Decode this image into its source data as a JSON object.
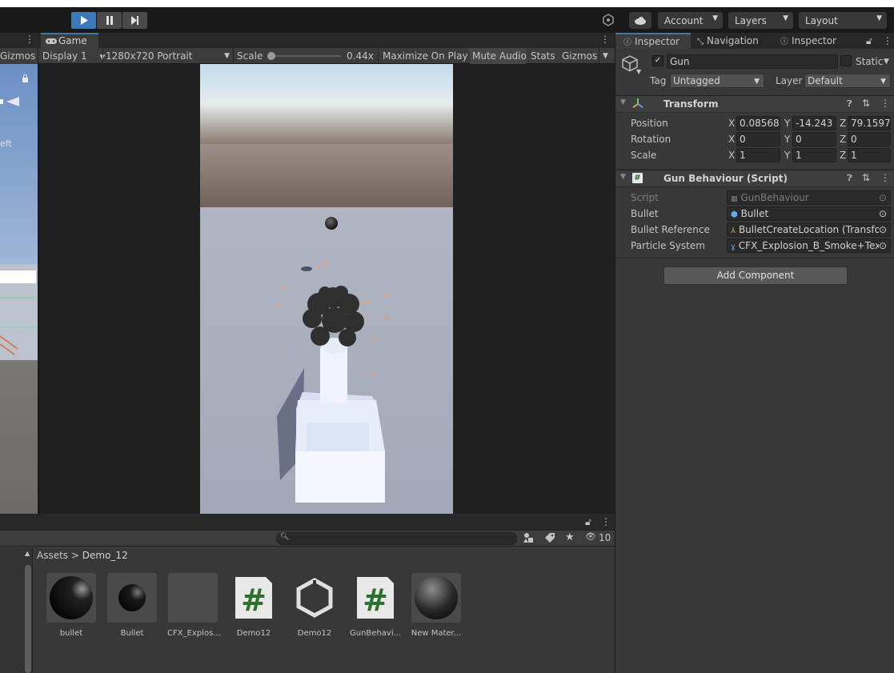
{
  "toolbar": {
    "account_label": "Account",
    "layers_label": "Layers",
    "layout_label": "Layout"
  },
  "scene_panel": {
    "gizmos_label": "Gizmos",
    "persp_fragment": "eft"
  },
  "game_panel": {
    "tab_label": "Game",
    "display_label": "Display 1",
    "resolution_label": "1280x720 Portrait",
    "scale_label": "Scale",
    "scale_value": "0.44x",
    "maximize_label": "Maximize On Play",
    "mute_label": "Mute Audio",
    "stats_label": "Stats",
    "gizmos_label": "Gizmos"
  },
  "inspector": {
    "tabs": [
      {
        "label": "Inspector"
      },
      {
        "label": "Navigation"
      },
      {
        "label": "Inspector"
      }
    ],
    "object_name": "Gun",
    "static_label": "Static",
    "tag_label": "Tag",
    "tag_value": "Untagged",
    "layer_label": "Layer",
    "layer_value": "Default",
    "transform": {
      "title": "Transform",
      "position_label": "Position",
      "rotation_label": "Rotation",
      "scale_label": "Scale",
      "position": {
        "x": "0.08568",
        "y": "-14.243",
        "z": "79.1597"
      },
      "rotation": {
        "x": "0",
        "y": "0",
        "z": "0"
      },
      "scale": {
        "x": "1",
        "y": "1",
        "z": "1"
      }
    },
    "gun_behaviour": {
      "title": "Gun Behaviour (Script)",
      "script_label": "Script",
      "script_value": "GunBehaviour",
      "bullet_label": "Bullet",
      "bullet_value": "Bullet",
      "bullet_ref_label": "Bullet Reference",
      "bullet_ref_value": "BulletCreateLocation (Transfo",
      "particle_label": "Particle System",
      "particle_value": "CFX_Explosion_B_Smoke+Text"
    },
    "add_component_label": "Add Component"
  },
  "project": {
    "breadcrumb_root": "Assets",
    "breadcrumb_sep": ">",
    "breadcrumb_folder": "Demo_12",
    "hidden_count": "10",
    "assets": [
      {
        "label": "bullet"
      },
      {
        "label": "Bullet"
      },
      {
        "label": "CFX_Explos..."
      },
      {
        "label": "Demo12"
      },
      {
        "label": "Demo12"
      },
      {
        "label": "GunBehavi..."
      },
      {
        "label": "New Mater..."
      }
    ]
  }
}
